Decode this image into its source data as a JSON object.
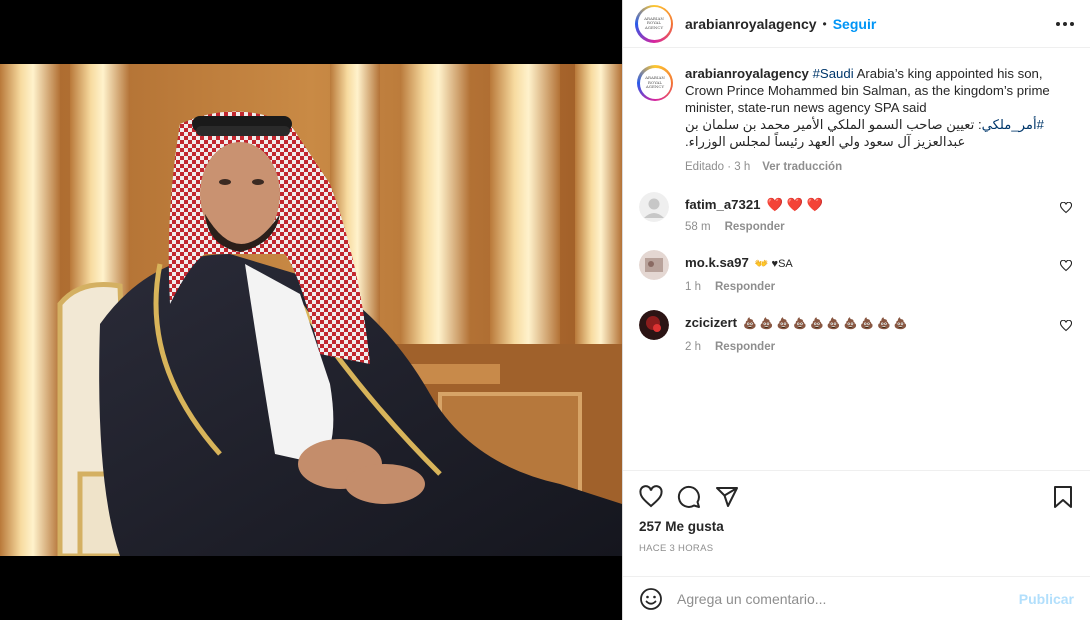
{
  "post": {
    "username": "arabianroyalagency",
    "follow_label": "Seguir",
    "dot": "•",
    "avatar_text": "ARABIAN ROYAL AGENCY"
  },
  "caption": {
    "username": "arabianroyalagency",
    "hashtag": "#Saudi",
    "text": " Arabia’s king appointed his son, Crown Prince Mohammed bin Salman, as the kingdom’s prime minister, state-run news agency SPA said",
    "arabic_hashtag": "#أمر_ملكي",
    "arabic_text": ": تعيين صاحب السمو الملكي الأمير محمد بن سلمان بن عبدالعزيز آل سعود ولي العهد رئيساً لمجلس الوزراء.",
    "edited": "Editado · 3 h",
    "translate_label": "Ver traducción"
  },
  "comments": [
    {
      "username": "fatim_a7321",
      "text": "❤️ ❤️ ❤️",
      "time": "58 m",
      "reply_label": "Responder",
      "avatar": "default-avatar"
    },
    {
      "username": "mo.k.sa97",
      "text": "👐 ♥SA",
      "time": "1 h",
      "reply_label": "Responder",
      "avatar": "photo-avatar"
    },
    {
      "username": "zcicizert",
      "text": "💩 💩 💩 💩 💩 💩 💩 💩 💩 💩",
      "time": "2 h",
      "reply_label": "Responder",
      "avatar": "dark-avatar"
    }
  ],
  "actions": {
    "likes": "257 Me gusta",
    "posted_time": "HACE 3 HORAS"
  },
  "add_comment": {
    "placeholder": "Agrega un comentario...",
    "publish_label": "Publicar"
  },
  "colors": {
    "link": "#0095f6",
    "hashtag": "#00376b",
    "muted": "#8e8e8e",
    "publish_disabled": "#b2dffc"
  }
}
